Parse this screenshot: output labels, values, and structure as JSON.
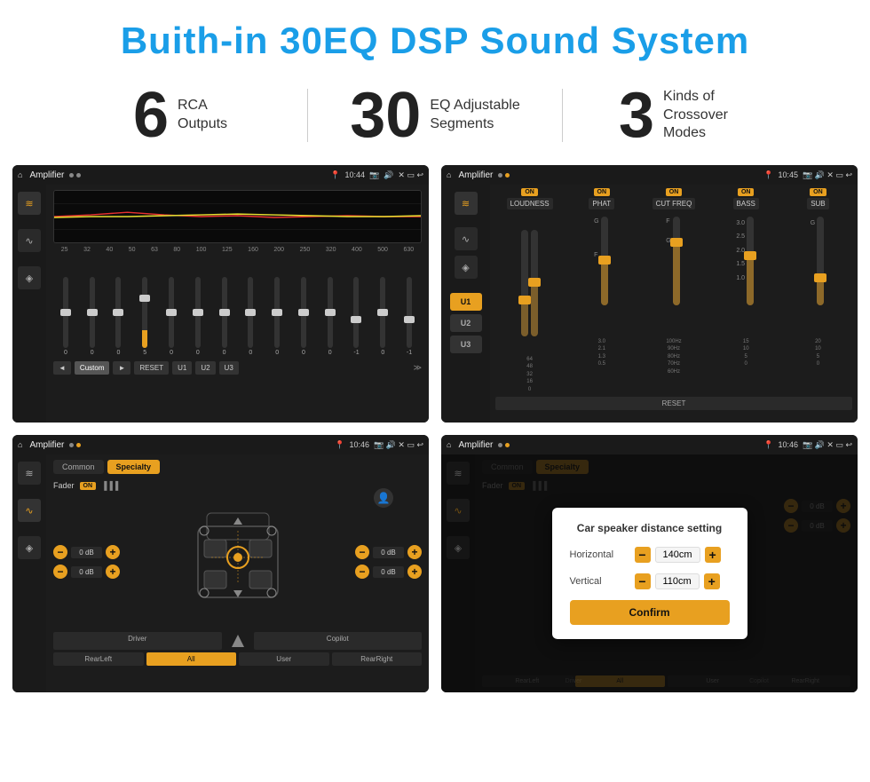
{
  "page": {
    "title": "Buith-in 30EQ DSP Sound System",
    "stats": [
      {
        "number": "6",
        "text_line1": "RCA",
        "text_line2": "Outputs"
      },
      {
        "number": "30",
        "text_line1": "EQ Adjustable",
        "text_line2": "Segments"
      },
      {
        "number": "3",
        "text_line1": "Kinds of",
        "text_line2": "Crossover Modes"
      }
    ]
  },
  "screen1": {
    "topbar_title": "Amplifier",
    "time": "10:44",
    "eq_freqs": [
      "25",
      "32",
      "40",
      "50",
      "63",
      "80",
      "100",
      "125",
      "160",
      "200",
      "250",
      "320",
      "400",
      "500",
      "630"
    ],
    "eq_values": [
      "0",
      "0",
      "0",
      "5",
      "0",
      "0",
      "0",
      "0",
      "0",
      "0",
      "0",
      "-1",
      "0",
      "-1"
    ],
    "bottom_btns": [
      "◄",
      "Custom",
      "►",
      "RESET",
      "U1",
      "U2",
      "U3"
    ]
  },
  "screen2": {
    "topbar_title": "Amplifier",
    "time": "10:45",
    "sidebar_btns": [
      "U1",
      "U2",
      "U3"
    ],
    "channels": [
      "LOUDNESS",
      "PHAT",
      "CUT FREQ",
      "BASS",
      "SUB"
    ],
    "reset_label": "RESET"
  },
  "screen3": {
    "topbar_title": "Amplifier",
    "time": "10:46",
    "tabs": [
      "Common",
      "Specialty"
    ],
    "fader_label": "Fader",
    "fader_on": "ON",
    "vol_controls": [
      {
        "label": "0 dB"
      },
      {
        "label": "0 dB"
      },
      {
        "label": "0 dB"
      },
      {
        "label": "0 dB"
      }
    ],
    "bottom_btns": [
      "Driver",
      "",
      "Copilot",
      "RearLeft",
      "All",
      "User",
      "RearRight"
    ]
  },
  "screen4": {
    "topbar_title": "Amplifier",
    "time": "10:46",
    "tabs": [
      "Common",
      "Specialty"
    ],
    "dialog": {
      "title": "Car speaker distance setting",
      "row1_label": "Horizontal",
      "row1_value": "140cm",
      "row2_label": "Vertical",
      "row2_value": "110cm",
      "confirm_label": "Confirm"
    },
    "bottom_btns": [
      "Driver",
      "Copilot",
      "RearLeft",
      "All",
      "User",
      "RearRight"
    ]
  },
  "icons": {
    "home": "⌂",
    "eq": "≋",
    "wave": "∿",
    "speaker": "◈",
    "person": "👤"
  }
}
